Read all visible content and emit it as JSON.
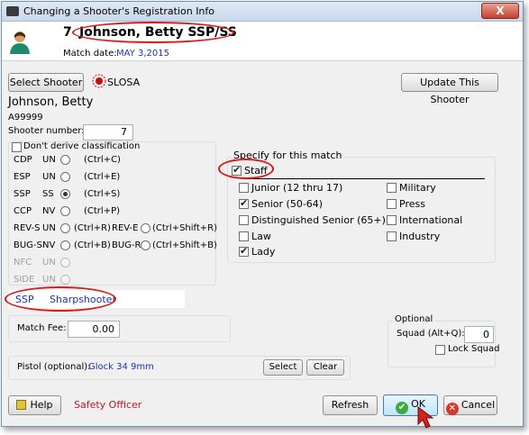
{
  "window": {
    "title": "Changing a Shooter's Registration Info",
    "close": "X"
  },
  "header": {
    "number": "7",
    "name": "Johnson, Betty   SSP/SS",
    "date_label": "Match date:",
    "date_value": "MAY  3,2015"
  },
  "top": {
    "select_shooter": "Select Shooter",
    "org": "SLOSA",
    "update_shooter": "Update This Shooter"
  },
  "shooter": {
    "name": "Johnson, Betty",
    "id": "A99999",
    "number_label": "Shooter number:",
    "number_value": "7",
    "dont_derive": "Don't derive classification"
  },
  "divisions": [
    {
      "div": "CDP",
      "cls": "UN",
      "key": "(Ctrl+C)"
    },
    {
      "div": "ESP",
      "cls": "UN",
      "key": "(Ctrl+E)"
    },
    {
      "div": "SSP",
      "cls": "SS",
      "key": "(Ctrl+S)"
    },
    {
      "div": "CCP",
      "cls": "NV",
      "key": "(Ctrl+P)"
    },
    {
      "div": "REV-S",
      "cls": "UN",
      "key": "(Ctrl+R)",
      "div2": "REV-E",
      "key2": "(Ctrl+Shift+R)"
    },
    {
      "div": "BUG-S",
      "cls": "NV",
      "key": "(Ctrl+B)",
      "div2": "BUG-R",
      "key2": "(Ctrl+Shift+B)"
    },
    {
      "div": "NFC",
      "cls": "UN"
    },
    {
      "div": "SIDE",
      "cls": "UN"
    }
  ],
  "specify": {
    "title": "Specify for this match",
    "staff": "Staff",
    "left": [
      "Junior (12 thru 17)",
      "Senior (50-64)",
      "Distinguished Senior (65+)",
      "Law",
      "Lady"
    ],
    "right": [
      "Military",
      "Press",
      "International",
      "Industry"
    ]
  },
  "classification": {
    "division": "SSP",
    "class": "Sharpshooter"
  },
  "fee": {
    "label": "Match Fee:",
    "value": "0.00"
  },
  "optional": {
    "title": "Optional",
    "squad_label": "Squad (Alt+Q):",
    "squad_value": "0",
    "lock_label": "Lock Squad"
  },
  "pistol": {
    "label": "Pistol (optional):",
    "value": "Glock  34    9mm",
    "select": "Select",
    "clear": "Clear"
  },
  "footer": {
    "help": "Help",
    "role": "Safety Officer",
    "refresh": "Refresh",
    "ok": "OK",
    "cancel": "Cancel"
  }
}
